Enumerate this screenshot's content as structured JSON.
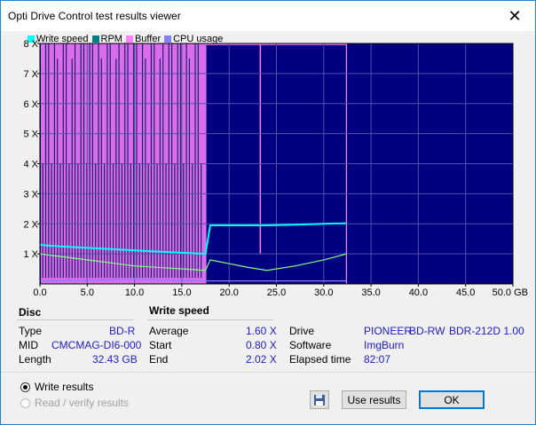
{
  "window": {
    "title": "Opti Drive Control test results viewer",
    "close": "✕"
  },
  "legend": [
    {
      "label": "Write speed",
      "color": "#00ffff"
    },
    {
      "label": "RPM",
      "color": "#008080"
    },
    {
      "label": "Buffer",
      "color": "#ff80ff"
    },
    {
      "label": "CPU usage",
      "color": "#8080ff"
    }
  ],
  "chart_data": {
    "type": "line",
    "xlabel": "",
    "ylabel": "",
    "x_unit": "GB",
    "xlim": [
      0,
      50
    ],
    "ylim": [
      0,
      8
    ],
    "x_ticks": [
      "0.0",
      "5.0",
      "10.0",
      "15.0",
      "20.0",
      "25.0",
      "30.0",
      "35.0",
      "40.0",
      "45.0",
      "50.0 GB"
    ],
    "y_ticks": [
      "1 X",
      "2 X",
      "3 X",
      "4 X",
      "5 X",
      "6 X",
      "7 X",
      "8 X"
    ],
    "grid": true,
    "legend_position": "top-left",
    "series": [
      {
        "name": "Write speed",
        "x": [
          0,
          2,
          5,
          8,
          11,
          14,
          17.5,
          18,
          21,
          24,
          27,
          30,
          32.4
        ],
        "y": [
          1.3,
          1.25,
          1.2,
          1.15,
          1.1,
          1.05,
          1.0,
          1.95,
          1.95,
          1.95,
          1.97,
          2.0,
          2.02
        ]
      },
      {
        "name": "RPM",
        "x": [
          0,
          5,
          10,
          17.5,
          18,
          22,
          24,
          27,
          30,
          32.4
        ],
        "y": [
          1.0,
          0.8,
          0.6,
          0.45,
          0.8,
          0.55,
          0.45,
          0.6,
          0.8,
          1.0
        ]
      },
      {
        "name": "Buffer",
        "x": [
          0,
          17.5,
          18,
          32.4
        ],
        "y": [
          8,
          8,
          8,
          8
        ]
      },
      {
        "name": "CPU usage",
        "x": [
          0,
          10,
          17.5,
          24,
          32.4
        ],
        "y": [
          0.1,
          0.15,
          0.1,
          0.1,
          0.1
        ]
      }
    ]
  },
  "disc": {
    "header": "Disc",
    "type_label": "Type",
    "type_value": "BD-R",
    "mid_label": "MID",
    "mid_value": "CMCMAG-DI6-000",
    "length_label": "Length",
    "length_value": "32.43 GB"
  },
  "speed": {
    "header": "Write speed",
    "avg_label": "Average",
    "avg_value": "1.60 X",
    "start_label": "Start",
    "start_value": "0.80 X",
    "end_label": "End",
    "end_value": "2.02 X"
  },
  "drive": {
    "drive_label": "Drive",
    "drive_vendor": "PIONEER",
    "drive_model": "BD-RW",
    "drive_rev": "BDR-212D 1.00",
    "software_label": "Software",
    "software_value": "ImgBurn",
    "elapsed_label": "Elapsed time",
    "elapsed_value": "82:07"
  },
  "options": {
    "write_results": "Write results",
    "read_results": "Read / verify results",
    "use_results": "Use results",
    "ok": "OK",
    "save_icon": "floppy-disk"
  }
}
